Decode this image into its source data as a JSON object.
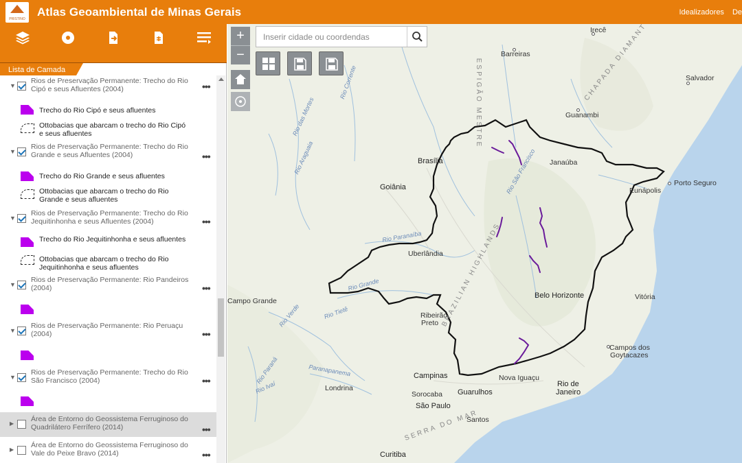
{
  "header": {
    "title": "Atlas Geoambiental de Minas Gerais",
    "logo_text": "PRISTINO",
    "links": [
      "Idealizadores",
      "De"
    ]
  },
  "toolbar": {
    "icons": [
      "layers-icon",
      "legend-icon",
      "export-icon",
      "print-icon",
      "menu-icon"
    ]
  },
  "panel": {
    "tab_label": "Lista de Camada",
    "layers": [
      {
        "name": "Rios de Preservação Permanente: Trecho do Rio Cipó e seus Afluentes (2004)",
        "checked": true,
        "legend": [
          {
            "type": "fill",
            "label": "Trecho do Rio Cipó e seus afluentes"
          },
          {
            "type": "dash",
            "label": "Ottobacias que abarcam o trecho do Rio Cipó e seus afluentes"
          }
        ]
      },
      {
        "name": "Rios de Preservação Permanente: Trecho do Rio Grande e seus Afluentes (2004)",
        "checked": true,
        "legend": [
          {
            "type": "fill",
            "label": "Trecho do Rio Grande e seus afluentes"
          },
          {
            "type": "dash",
            "label": "Ottobacias que abarcam o trecho do Rio Grande e seus afluentes"
          }
        ]
      },
      {
        "name": "Rios de Preservação Permanente: Trecho do Rio Jequitinhonha e seus Afluentes (2004)",
        "checked": true,
        "legend": [
          {
            "type": "fill",
            "label": "Trecho do Rio Jequitinhonha e seus afluentes"
          },
          {
            "type": "dash",
            "label": "Ottobacias que abarcam o trecho do Rio Jequitinhonha e seus afluentes"
          }
        ]
      },
      {
        "name": "Rios de Preservação Permanente: Rio Pandeiros (2004)",
        "checked": true,
        "legend": [
          {
            "type": "fill",
            "label": ""
          }
        ]
      },
      {
        "name": "Rios de Preservação Permanente: Rio Peruaçu (2004)",
        "checked": true,
        "legend": [
          {
            "type": "fill",
            "label": ""
          }
        ]
      },
      {
        "name": "Rios de Preservação Permanente: Trecho do Rio São Francisco (2004)",
        "checked": true,
        "legend": [
          {
            "type": "fill",
            "label": ""
          }
        ]
      },
      {
        "name": "Área de Entorno do Geossistema Ferruginoso do Quadrilátero Ferrífero (2014)",
        "checked": false,
        "legend": []
      },
      {
        "name": "Área de Entorno do Geossistema Ferruginoso do Vale do Peixe Bravo (2014)",
        "checked": false,
        "legend": []
      }
    ]
  },
  "map": {
    "search_placeholder": "Inserir cidade ou coordendas",
    "zoom_in": "+",
    "zoom_out": "−",
    "places": {
      "irece": "Irecê",
      "barreiras": "Barreiras",
      "salvador": "Salvador",
      "guanambi": "Guanambi",
      "brasilia": "Brasília",
      "janauba": "Janaúba",
      "goiania": "Goiânia",
      "eunapolis": "Eunápolis",
      "porto_seguro": "Porto Seguro",
      "uberlandia": "Uberlândia",
      "belo_horizonte": "Belo Horizonte",
      "vitoria": "Vitória",
      "campo_grande": "Campo Grande",
      "ribeirao_preto_1": "Ribeirão",
      "ribeirao_preto_2": "Preto",
      "campos_1": "Campos dos",
      "campos_2": "Goytacazes",
      "campinas": "Campinas",
      "nova_iguacu": "Nova Iguaçu",
      "rio_1": "Rio de",
      "rio_2": "Janeiro",
      "londrina": "Londrina",
      "sorocaba": "Sorocaba",
      "guarulhos": "Guarulhos",
      "sao_paulo": "São Paulo",
      "santos": "Santos",
      "curitiba": "Curitiba"
    },
    "regions": {
      "chapada": "CHAPADA DIAMANT",
      "espigao": "ESPIGÃO MESTRE",
      "brazilian": "BRAZILIAN HIGHLANDS",
      "serra_mar": "SERRA DO MAR"
    },
    "rivers": {
      "rio_das_mortes": "Rio das Mortes",
      "rio_araguaia": "Rio Araguaia",
      "rio_grande": "Rio Grande",
      "rio_parana": "Rio Paraná",
      "rio_tiete": "Rio Tietê",
      "rio_ivai": "Rio Ivaí",
      "rio_paranaiba": "Rio Paranaíba",
      "rio_verde": "Rio Verde",
      "paranapanema": "Paranapanema",
      "rio_corrente": "Rio Corrente",
      "rio_sao_francisco": "Rio São Francisco"
    },
    "colors": {
      "boundary": "#111111",
      "river_highlight": "#6a1b9a",
      "ocean": "#b9d4ec",
      "header": "#e87e0c"
    }
  }
}
